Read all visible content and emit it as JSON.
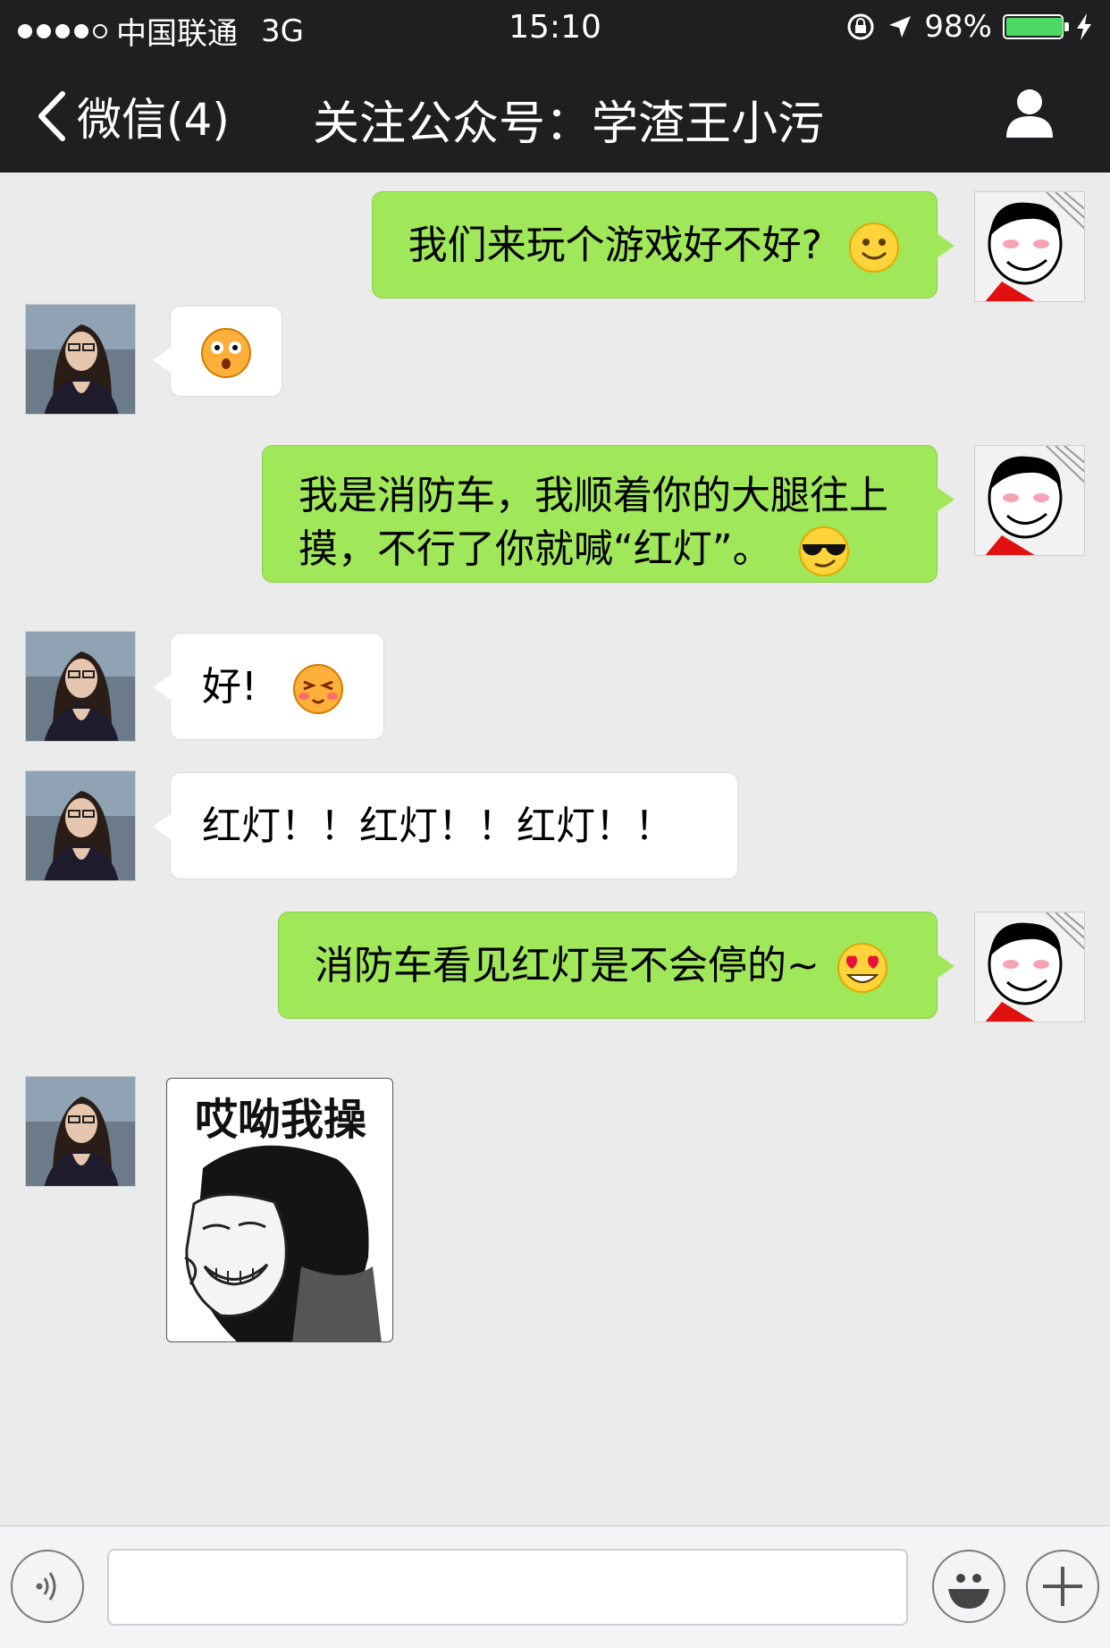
{
  "status_bar": {
    "carrier": "中国联通",
    "network": "3G",
    "time": "15:10",
    "battery_percent": "98%",
    "battery_level": 0.98,
    "signal_bars_filled": 4,
    "icons": [
      "signal-dots-icon",
      "orientation-lock-icon",
      "location-arrow-icon",
      "battery-icon",
      "charging-bolt-icon"
    ]
  },
  "nav_bar": {
    "back_label": "微信(4)",
    "title": "关注公众号：学渣王小污",
    "profile_icon": "person-icon"
  },
  "messages": [
    {
      "side": "sent",
      "text": "我们来玩个游戏好不好?",
      "emoji": "smile-emoji"
    },
    {
      "side": "received",
      "text": "",
      "emoji": "surprised-emoji"
    },
    {
      "side": "sent",
      "line1": "我是消防车，我顺着你的大腿往上",
      "line2": "摸，不行了你就喊“红灯”。",
      "emoji": "sunglasses-emoji"
    },
    {
      "side": "received",
      "text": "好!",
      "emoji": "blush-emoji"
    },
    {
      "side": "received",
      "text": "红灯！！红灯！！红灯！！"
    },
    {
      "side": "sent",
      "text": "消防车看见红灯是不会停的~",
      "emoji": "heart-eyes-emoji"
    },
    {
      "side": "received",
      "type": "sticker",
      "sticker_text": "哎呦我操"
    }
  ],
  "input_bar": {
    "placeholder": "",
    "voice_icon": "voice-icon",
    "emoji_icon": "emoji-icon",
    "plus_icon": "plus-icon"
  },
  "colors": {
    "bar_bg": "#1f1f21",
    "chat_bg": "#ebebeb",
    "sent_bubble": "#a0e75a",
    "received_bubble": "#ffffff",
    "battery_green": "#4cd964"
  }
}
